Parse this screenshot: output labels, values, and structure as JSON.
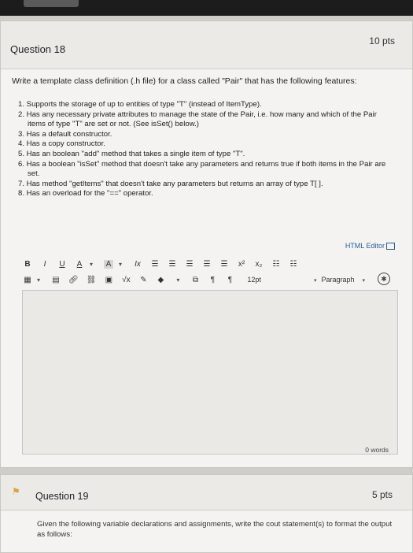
{
  "question18": {
    "title": "Question 18",
    "points": "10 pts",
    "prompt": "Write a template class definition (.h file) for a class called \"Pair\" that has the following features:",
    "features": [
      "1. Supports the storage of up to entities of type \"T\" (instead of ItemType).",
      "2. Has any necessary private attributes to manage the state of the Pair, i.e. how many and which of the Pair items of type \"T\" are set or not. (See isSet() below.)",
      "3. Has a default constructor.",
      "4. Has a copy constructor.",
      "5. Has an boolean \"add\" method that takes a single item of type \"T\".",
      "6. Has a boolean \"isSet\" method that doesn't take any parameters and returns true if both items in the Pair are set.",
      "7. Has method \"getItems\" that doesn't take any parameters but returns an array of type T[ ].",
      "8. Has an overload for the \"==\" operator."
    ]
  },
  "editor": {
    "html_editor_label": "HTML Editor",
    "toolbar_row1": {
      "bold": "B",
      "italic": "I",
      "underline": "U",
      "font_color": "A",
      "highlight": "A",
      "clear_format": "Ix",
      "superscript": "x²",
      "subscript": "x₂"
    },
    "toolbar_row2": {
      "ltr": "¶",
      "rtl": "¶",
      "font_size": "12pt",
      "format": "Paragraph"
    },
    "word_count": "0 words",
    "icons": {
      "dropdown": "chevron-down-icon",
      "align_left": "align-left-icon",
      "align_center": "align-center-icon",
      "align_right": "align-right-icon",
      "align_justify": "align-justify-icon",
      "bulleted_list": "bulleted-list-icon",
      "numbered_list": "numbered-list-icon",
      "table": "table-icon",
      "media": "media-icon",
      "link": "link-icon",
      "unlink": "unlink-icon",
      "image": "image-icon",
      "equation": "equation-icon",
      "paint": "paint-icon",
      "embed": "embed-icon",
      "accessibility": "accessibility-icon"
    }
  },
  "question19": {
    "title": "Question 19",
    "points": "5 pts",
    "prompt": "Given the following variable declarations and assignments, write the cout statement(s) to format the output as follows:"
  }
}
